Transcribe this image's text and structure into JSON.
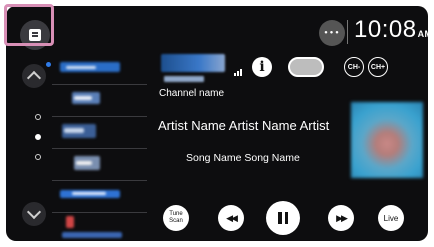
{
  "status_bar": {
    "time": "10:08",
    "ampm": "AM",
    "more_symbol": "•••"
  },
  "now_playing": {
    "channel_name": "Channel name",
    "artist_name": "Artist Name Artist Name Artist",
    "song_name": "Song Name Song Name"
  },
  "buttons": {
    "info_label": "i",
    "ch_minus_label": "CH-",
    "ch_plus_label": "CH+",
    "tune_scan_line1": "Tune",
    "tune_scan_line2": "Scan",
    "live_label": "Live"
  },
  "icons": {
    "menu": "list-menu-icon",
    "more": "more-options-icon",
    "up": "chevron-up-icon",
    "down": "chevron-down-icon",
    "signal": "signal-strength-icon",
    "info": "info-icon",
    "prev": "skip-back-icon",
    "pause": "pause-icon",
    "next": "skip-forward-icon"
  },
  "preset_list": {
    "count": 6,
    "selected_index": 0,
    "pages": 3,
    "current_page": 1
  },
  "colors": {
    "background": "#0d0d0f",
    "highlight": "#d88fb6",
    "accent_blue": "#2f7be8",
    "text": "#ffffff"
  }
}
